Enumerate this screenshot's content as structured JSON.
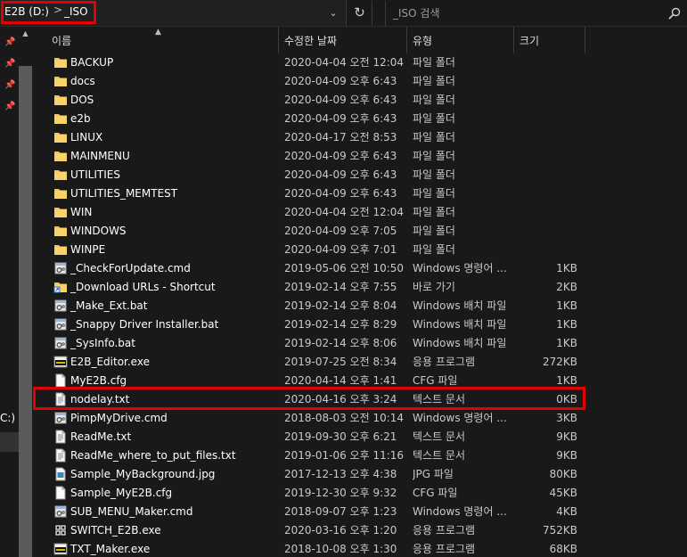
{
  "address": {
    "drive": "E2B (D:)",
    "folder": "_ISO",
    "separator": ">",
    "dropdown_glyph": "⌄",
    "refresh_glyph": "↻"
  },
  "search": {
    "placeholder": "_ISO 검색"
  },
  "nav": {
    "fragment": "C:)"
  },
  "columns": {
    "name": "이름",
    "date": "수정한 날짜",
    "type": "유형",
    "size": "크기"
  },
  "colors": {
    "highlight": "#e40000",
    "folder": "#f2c54a",
    "background": "#191919"
  },
  "files": [
    {
      "name": "BACKUP",
      "date": "2020-04-04 오전 12:04",
      "type": "파일 폴더",
      "size": "",
      "icon": "folder-icon"
    },
    {
      "name": "docs",
      "date": "2020-04-09 오후 6:43",
      "type": "파일 폴더",
      "size": "",
      "icon": "folder-icon"
    },
    {
      "name": "DOS",
      "date": "2020-04-09 오후 6:43",
      "type": "파일 폴더",
      "size": "",
      "icon": "folder-icon"
    },
    {
      "name": "e2b",
      "date": "2020-04-09 오후 6:43",
      "type": "파일 폴더",
      "size": "",
      "icon": "folder-icon"
    },
    {
      "name": "LINUX",
      "date": "2020-04-17 오전 8:53",
      "type": "파일 폴더",
      "size": "",
      "icon": "folder-icon"
    },
    {
      "name": "MAINMENU",
      "date": "2020-04-09 오후 6:43",
      "type": "파일 폴더",
      "size": "",
      "icon": "folder-icon"
    },
    {
      "name": "UTILITIES",
      "date": "2020-04-09 오후 6:43",
      "type": "파일 폴더",
      "size": "",
      "icon": "folder-icon"
    },
    {
      "name": "UTILITIES_MEMTEST",
      "date": "2020-04-09 오후 6:43",
      "type": "파일 폴더",
      "size": "",
      "icon": "folder-icon"
    },
    {
      "name": "WIN",
      "date": "2020-04-04 오전 12:04",
      "type": "파일 폴더",
      "size": "",
      "icon": "folder-icon"
    },
    {
      "name": "WINDOWS",
      "date": "2020-04-09 오후 7:05",
      "type": "파일 폴더",
      "size": "",
      "icon": "folder-icon"
    },
    {
      "name": "WINPE",
      "date": "2020-04-09 오후 7:01",
      "type": "파일 폴더",
      "size": "",
      "icon": "folder-icon"
    },
    {
      "name": "_CheckForUpdate.cmd",
      "date": "2019-05-06 오전 10:50",
      "type": "Windows 명령어 ...",
      "size": "1KB",
      "icon": "script-gear-icon"
    },
    {
      "name": "_Download URLs - Shortcut",
      "date": "2019-02-14 오후 7:55",
      "type": "바로 가기",
      "size": "2KB",
      "icon": "shortcut-icon"
    },
    {
      "name": "_Make_Ext.bat",
      "date": "2019-02-14 오후 8:04",
      "type": "Windows 배치 파일",
      "size": "1KB",
      "icon": "script-gear-icon"
    },
    {
      "name": "_Snappy Driver Installer.bat",
      "date": "2019-02-14 오후 8:29",
      "type": "Windows 배치 파일",
      "size": "1KB",
      "icon": "script-gear-icon"
    },
    {
      "name": "_SysInfo.bat",
      "date": "2019-02-14 오후 8:06",
      "type": "Windows 배치 파일",
      "size": "1KB",
      "icon": "script-gear-icon"
    },
    {
      "name": "E2B_Editor.exe",
      "date": "2019-07-25 오전 8:34",
      "type": "응용 프로그램",
      "size": "272KB",
      "icon": "app-e2b-icon"
    },
    {
      "name": "MyE2B.cfg",
      "date": "2020-04-14 오후 1:41",
      "type": "CFG 파일",
      "size": "1KB",
      "icon": "blank-file-icon"
    },
    {
      "name": "nodelay.txt",
      "date": "2020-04-16 오후 3:24",
      "type": "텍스트 문서",
      "size": "0KB",
      "icon": "text-file-icon"
    },
    {
      "name": "PimpMyDrive.cmd",
      "date": "2018-08-03 오전 10:14",
      "type": "Windows 명령어 ...",
      "size": "3KB",
      "icon": "script-gear-icon"
    },
    {
      "name": "ReadMe.txt",
      "date": "2019-09-30 오후 6:21",
      "type": "텍스트 문서",
      "size": "9KB",
      "icon": "text-file-icon"
    },
    {
      "name": "ReadMe_where_to_put_files.txt",
      "date": "2019-01-06 오후 11:16",
      "type": "텍스트 문서",
      "size": "9KB",
      "icon": "text-file-icon"
    },
    {
      "name": "Sample_MyBackground.jpg",
      "date": "2017-12-13 오후 4:38",
      "type": "JPG 파일",
      "size": "80KB",
      "icon": "image-file-icon"
    },
    {
      "name": "Sample_MyE2B.cfg",
      "date": "2019-12-30 오후 9:32",
      "type": "CFG 파일",
      "size": "45KB",
      "icon": "blank-file-icon"
    },
    {
      "name": "SUB_MENU_Maker.cmd",
      "date": "2018-09-07 오후 1:23",
      "type": "Windows 명령어 ...",
      "size": "4KB",
      "icon": "script-gear-icon"
    },
    {
      "name": "SWITCH_E2B.exe",
      "date": "2020-03-16 오후 1:20",
      "type": "응용 프로그램",
      "size": "752KB",
      "icon": "app-switch-icon"
    },
    {
      "name": "TXT_Maker.exe",
      "date": "2018-10-08 오후 1:30",
      "type": "응용 프로그램",
      "size": "68KB",
      "icon": "app-e2b-icon"
    }
  ]
}
